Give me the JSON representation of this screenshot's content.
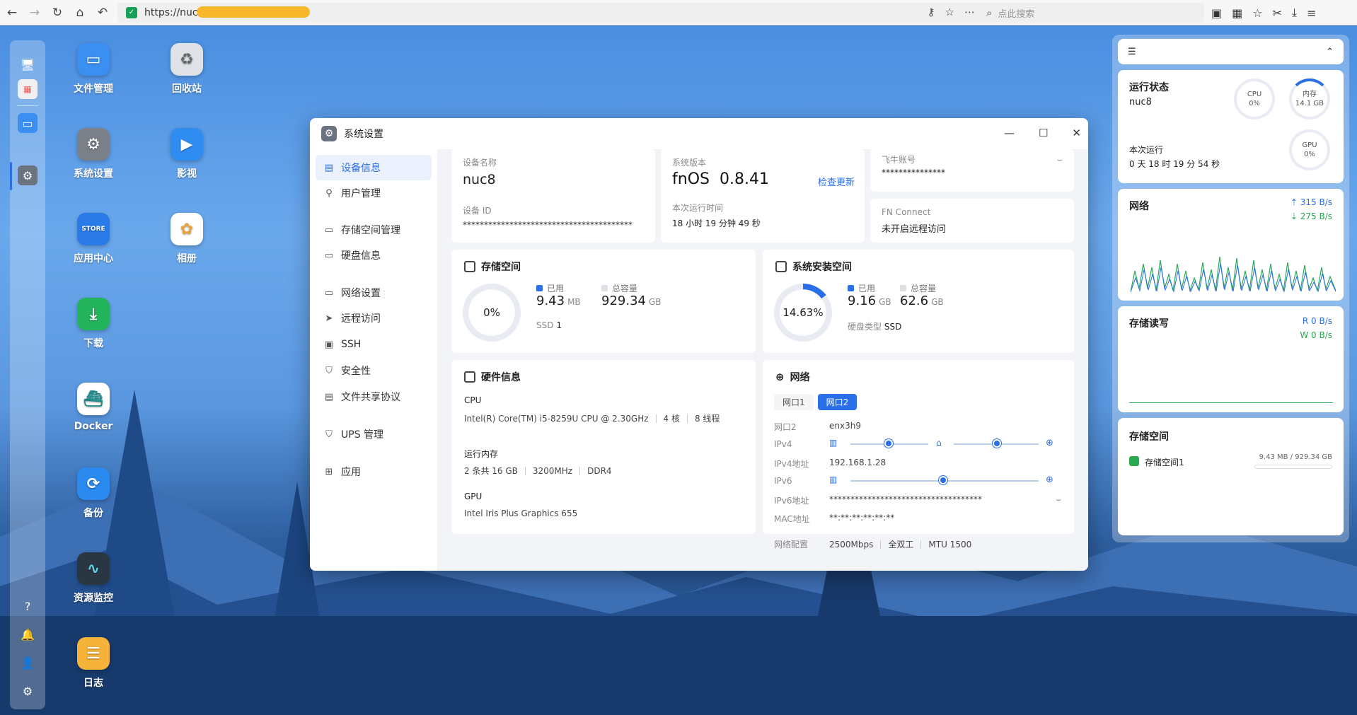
{
  "browser": {
    "url": "https://nuc",
    "search_placeholder": "点此搜索"
  },
  "desktop_apps": [
    {
      "label": "文件管理",
      "icon": "folder-icon",
      "color": "#3b8ff0"
    },
    {
      "label": "回收站",
      "icon": "recycle-bin-icon",
      "color": "#d8dde4"
    },
    {
      "label": "系统设置",
      "icon": "gear-icon",
      "color": "#7b8089"
    },
    {
      "label": "影视",
      "icon": "video-icon",
      "color": "#2f8cf0"
    },
    {
      "label": "应用中心",
      "icon": "store-icon",
      "color": "#2a7be8"
    },
    {
      "label": "相册",
      "icon": "photos-icon",
      "color": "#ffffff"
    },
    {
      "label": "下载",
      "icon": "download-icon",
      "color": "#23b35a"
    },
    {
      "label": "Docker",
      "icon": "docker-icon",
      "color": "#ffffff"
    },
    {
      "label": "备份",
      "icon": "backup-icon",
      "color": "#2a8af0"
    },
    {
      "label": "资源监控",
      "icon": "monitor-icon",
      "color": "#2a3642"
    },
    {
      "label": "日志",
      "icon": "log-icon",
      "color": "#f6b33a"
    }
  ],
  "window": {
    "title": "系统设置",
    "sidebar": [
      {
        "label": "设备信息",
        "icon": "device-icon",
        "selected": true
      },
      {
        "label": "用户管理",
        "icon": "user-icon"
      },
      {
        "label": "存储空间管理",
        "icon": "storage-icon"
      },
      {
        "label": "硬盘信息",
        "icon": "disk-icon"
      },
      {
        "label": "网络设置",
        "icon": "network-icon"
      },
      {
        "label": "远程访问",
        "icon": "remote-icon"
      },
      {
        "label": "SSH",
        "icon": "ssh-icon"
      },
      {
        "label": "安全性",
        "icon": "shield-icon"
      },
      {
        "label": "文件共享协议",
        "icon": "file-share-icon"
      },
      {
        "label": "UPS 管理",
        "icon": "ups-icon"
      },
      {
        "label": "应用",
        "icon": "apps-icon"
      }
    ],
    "device": {
      "name_label": "设备名称",
      "name": "nuc8",
      "id_label": "设备 ID",
      "id": "****************************************",
      "version_label": "系统版本",
      "version_os": "fnOS",
      "version_num": "0.8.41",
      "check_update": "检查更新",
      "uptime_label": "本次运行时间",
      "uptime": "18 小时 19 分钟 49 秒",
      "account_label": "飞牛账号",
      "account": "***************",
      "fnconnect_label": "FN Connect",
      "fnconnect": "未开启远程访问"
    },
    "storage": {
      "title": "存储空间",
      "percent_text": "0%",
      "used_fraction": 0.0,
      "used_label": "已用",
      "used": "9.43",
      "used_unit": "MB",
      "total_label": "总容量",
      "total": "929.34",
      "total_unit": "GB",
      "ssd_label": "SSD",
      "ssd_count": "1"
    },
    "sysinstall": {
      "title": "系统安装空间",
      "percent_text": "14.63%",
      "used_fraction": 0.1463,
      "used_label": "已用",
      "used": "9.16",
      "used_unit": "GB",
      "total_label": "总容量",
      "total": "62.6",
      "total_unit": "GB",
      "disk_type_label": "硬盘类型",
      "disk_type": "SSD"
    },
    "hardware": {
      "title": "硬件信息",
      "cpu_label": "CPU",
      "cpu_model": "Intel(R) Core(TM) i5-8259U CPU @ 2.30GHz",
      "cpu_cores": "4 核",
      "cpu_threads": "8 线程",
      "mem_label": "运行内存",
      "mem_size": "2 条共 16 GB",
      "mem_speed": "3200MHz",
      "mem_type": "DDR4",
      "gpu_label": "GPU",
      "gpu_model": "Intel Iris Plus Graphics 655"
    },
    "network": {
      "title": "网络",
      "tabs": [
        "网口1",
        "网口2"
      ],
      "active_tab": 1,
      "port_label": "网口2",
      "port_value": "enx3h9",
      "ipv4_label": "IPv4",
      "ipv4addr_label": "IPv4地址",
      "ipv4addr": "192.168.1.28",
      "ipv6_label": "IPv6",
      "ipv6addr_label": "IPv6地址",
      "ipv6addr": "************************************",
      "mac_label": "MAC地址",
      "mac": "**:**:**:**:**:**",
      "config_label": "网络配置",
      "speed": "2500Mbps",
      "duplex": "全双工",
      "mtu": "MTU 1500"
    }
  },
  "widgets": {
    "status": {
      "title": "运行状态",
      "hostname": "nuc8",
      "cpu_label": "CPU",
      "cpu_value": "0%",
      "mem_label": "内存",
      "mem_value": "14.1 GB",
      "gpu_label": "GPU",
      "gpu_value": "0%",
      "uptime_label": "本次运行",
      "uptime": "0 天 18 时 19 分 54 秒"
    },
    "network": {
      "title": "网络",
      "up": "315 B/s",
      "down": "275 B/s"
    },
    "disk_io": {
      "title": "存储读写",
      "read": "R  0 B/s",
      "write": "W  0 B/s"
    },
    "storage": {
      "title": "存储空间",
      "pool_name": "存储空间1",
      "usage": "9.43 MB / 929.34 GB"
    }
  }
}
